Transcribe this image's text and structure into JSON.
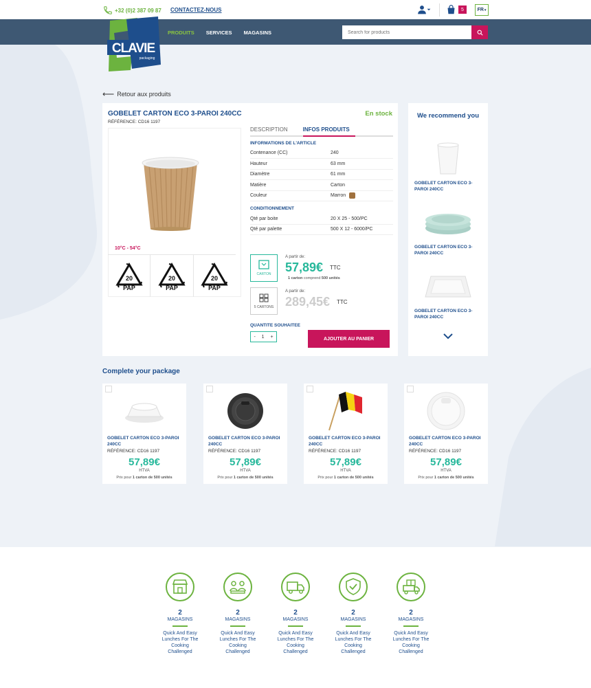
{
  "topbar": {
    "phone": "+32 (0)2 387 09 87",
    "contact": "CONTACTEZ-NOUS",
    "cart_count": "5",
    "language": "FR"
  },
  "header": {
    "logo_text": "CLAVIE",
    "logo_sub": "packaging",
    "nav": [
      "PRODUITS",
      "SERVICES",
      "MAGASINS"
    ],
    "search_placeholder": "Search for products"
  },
  "back_link": "Retour aux produits",
  "product": {
    "title": "GOBELET CARTON ECO 3-PAROI 240CC",
    "reference": "RÉFÉRENCE: CD16 1197",
    "stock": "En stock",
    "temperature": "10°C - 54°C",
    "recycle_code": "20",
    "recycle_label": "PAP",
    "tabs": [
      "DESCRIPTION",
      "INFOS PRODUITS"
    ],
    "info_heading": "INFORMATIONS DE L'ARTICLE",
    "info": [
      {
        "k": "Contenance (CC)",
        "v": "240"
      },
      {
        "k": "Hauteur",
        "v": "63 mm"
      },
      {
        "k": "Diamètre",
        "v": "61 mm"
      },
      {
        "k": "Matière",
        "v": "Carton"
      },
      {
        "k": "Couleur",
        "v": "Marron"
      }
    ],
    "pack_heading": "CONDITIONNEMENT",
    "pack": [
      {
        "k": "Qté par boite",
        "v": "20 X 25 - 500/PC"
      },
      {
        "k": "Qté par palette",
        "v": "500 X 12 - 6000/PC"
      }
    ],
    "price_carton_label": "CARTON",
    "price_from": "A partir de:",
    "price_carton": "57,89€",
    "price_unit": "TTC",
    "carton_info_a": "1 carton",
    "carton_info_b": " comprend ",
    "carton_info_c": "500 unités",
    "price_5_label": "5 CARTONS",
    "price_5": "289,45€",
    "qty_label": "QUANTITE SOUHAITEE",
    "qty_minus": "-",
    "qty_value": "1",
    "qty_plus": "+",
    "add_to_cart": "AJOUTER AU PANIER"
  },
  "recommend": {
    "title": "We recommend you",
    "items": [
      {
        "name": "GOBELET CARTON ECO 3-PAROI 240CC"
      },
      {
        "name": "GOBELET CARTON ECO 3-PAROI 240CC"
      },
      {
        "name": "GOBELET CARTON ECO 3-PAROI 240CC"
      }
    ]
  },
  "package": {
    "title": "Complete your package",
    "items": [
      {
        "name": "GOBELET CARTON ECO 3-PAROI 240CC",
        "ref": "RÉFÉRENCE: CD16 1197",
        "price": "57,89€",
        "tax": "HTVA",
        "unit_a": "Prix pour ",
        "unit_b": "1 carton de 500 unités"
      },
      {
        "name": "GOBELET CARTON ECO 3-PAROI 240CC",
        "ref": "RÉFÉRENCE: CD16 1197",
        "price": "57,89€",
        "tax": "HTVA",
        "unit_a": "Prix pour ",
        "unit_b": "1 carton de 500 unités"
      },
      {
        "name": "GOBELET CARTON ECO 3-PAROI 240CC",
        "ref": "RÉFÉRENCE: CD16 1197",
        "price": "57,89€",
        "tax": "HTVA",
        "unit_a": "Prix pour ",
        "unit_b": "1 carton de 500 unités"
      },
      {
        "name": "GOBELET CARTON ECO 3-PAROI 240CC",
        "ref": "RÉFÉRENCE: CD16 1197",
        "price": "57,89€",
        "tax": "HTVA",
        "unit_a": "Prix pour ",
        "unit_b": "1 carton de 500 unités"
      }
    ]
  },
  "features": [
    {
      "icon": "store-icon",
      "num": "2",
      "label": "MAGASINS",
      "desc": "Quick And Easy Lunches For The Cooking Challenged"
    },
    {
      "icon": "people-icon",
      "num": "2",
      "label": "MAGASINS",
      "desc": "Quick And Easy Lunches For The Cooking Challenged"
    },
    {
      "icon": "truck-icon",
      "num": "2",
      "label": "MAGASINS",
      "desc": "Quick And Easy Lunches For The Cooking Challenged"
    },
    {
      "icon": "shield-check-icon",
      "num": "2",
      "label": "MAGASINS",
      "desc": "Quick And Easy Lunches For The Cooking Challenged"
    },
    {
      "icon": "gift-truck-icon",
      "num": "2",
      "label": "MAGASINS",
      "desc": "Quick And Easy Lunches For The Cooking Challenged"
    }
  ],
  "colors": {
    "accent": "#c8155b",
    "green": "#6cb33f",
    "teal": "#27b89b",
    "navy": "#1e4e8c",
    "nav_bg": "#3e5873"
  }
}
